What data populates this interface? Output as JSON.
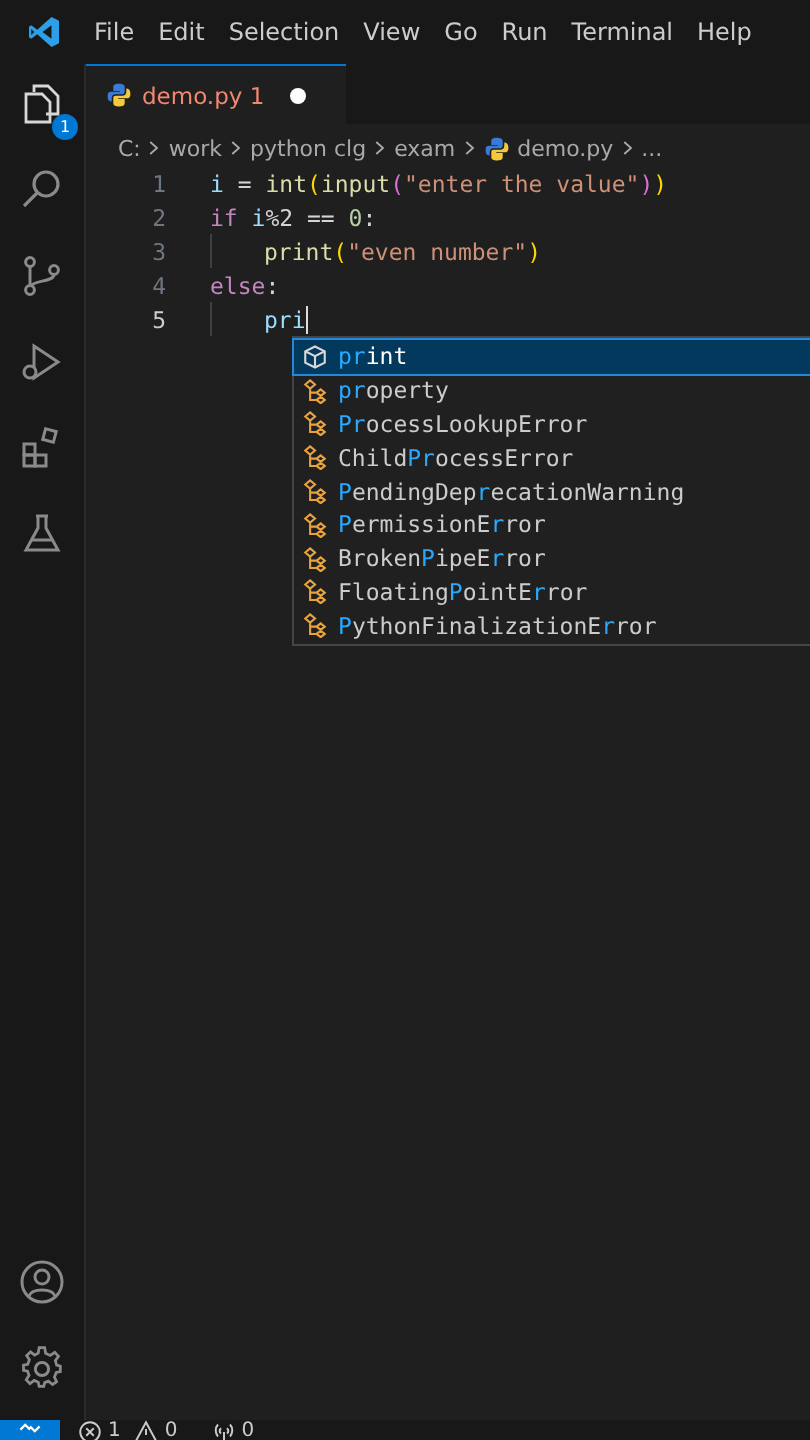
{
  "menu": [
    "File",
    "Edit",
    "Selection",
    "View",
    "Go",
    "Run",
    "Terminal",
    "Help"
  ],
  "activity_bar": {
    "explorer_badge": "1"
  },
  "tab": {
    "label": "demo.py 1",
    "modified": true
  },
  "breadcrumb": [
    "C:",
    "work",
    "python clg",
    "exam",
    "demo.py",
    "..."
  ],
  "code": [
    {
      "number": "1",
      "indent": false,
      "current": false,
      "tokens": [
        {
          "kind": "variable",
          "text": "i"
        },
        {
          "kind": "plain",
          "text": " = "
        },
        {
          "kind": "function",
          "text": "int"
        },
        {
          "kind": "bracket",
          "text": "("
        },
        {
          "kind": "function",
          "text": "input"
        },
        {
          "kind": "bracket2",
          "text": "("
        },
        {
          "kind": "string",
          "text": "\"enter the value\""
        },
        {
          "kind": "bracket2",
          "text": ")"
        },
        {
          "kind": "bracket",
          "text": ")"
        }
      ]
    },
    {
      "number": "2",
      "indent": false,
      "current": false,
      "tokens": [
        {
          "kind": "keyword",
          "text": "if"
        },
        {
          "kind": "variable",
          "text": " i"
        },
        {
          "kind": "plain",
          "text": "%2 == "
        },
        {
          "kind": "number",
          "text": "0"
        },
        {
          "kind": "plain",
          "text": ":"
        }
      ]
    },
    {
      "number": "3",
      "indent": true,
      "current": false,
      "tokens": [
        {
          "kind": "function",
          "text": "print"
        },
        {
          "kind": "bracket",
          "text": "("
        },
        {
          "kind": "string",
          "text": "\"even number\""
        },
        {
          "kind": "bracket",
          "text": ")"
        }
      ]
    },
    {
      "number": "4",
      "indent": false,
      "current": false,
      "tokens": [
        {
          "kind": "keyword",
          "text": "else"
        },
        {
          "kind": "plain",
          "text": ":"
        }
      ]
    },
    {
      "number": "5",
      "indent": true,
      "current": true,
      "tokens": [
        {
          "kind": "variable",
          "text": "pri"
        }
      ]
    }
  ],
  "suggestions": [
    {
      "kind": "method",
      "label": "**pr**int",
      "selected": true
    },
    {
      "kind": "class",
      "label": "**pr**operty",
      "selected": false
    },
    {
      "kind": "class",
      "label": "**Pr**ocessLookupError",
      "selected": false
    },
    {
      "kind": "class",
      "label": "Child**Pr**ocessError",
      "selected": false
    },
    {
      "kind": "class",
      "label": "**P**endingDep**r**ecationWarning",
      "selected": false
    },
    {
      "kind": "class",
      "label": "**P**ermissionE**r**ror",
      "selected": false
    },
    {
      "kind": "class",
      "label": "Broken**P**ipeE**r**ror",
      "selected": false
    },
    {
      "kind": "class",
      "label": "Floating**P**ointE**r**ror",
      "selected": false
    },
    {
      "kind": "class",
      "label": "**P**ythonFinalizationE**r**ror",
      "selected": false
    }
  ],
  "status_bar": {
    "errors": "1",
    "warnings": "0",
    "ports": "0"
  }
}
